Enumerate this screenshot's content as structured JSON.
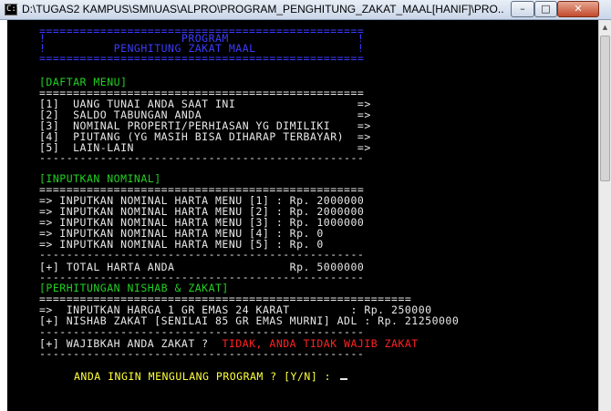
{
  "window": {
    "title": "D:\\TUGAS2 KAMPUS\\SMI\\UAS\\ALPRO\\PROGRAM_PENGHITUNG_ZAKAT_MAAL[HANIF]\\PRO...",
    "icon_label": "C:\\",
    "buttons": {
      "minimize": "–",
      "maximize": "□",
      "close": "✕"
    }
  },
  "console": {
    "header": {
      "border_top": "================================================",
      "line1": "!                    PROGRAM                   !",
      "line2": "!          PENGHITUNG ZAKAT MAAL               !",
      "border_bottom": "================================================"
    },
    "menu": {
      "heading": "[DAFTAR MENU]",
      "rule": "================================================",
      "items": [
        "[1]  UANG TUNAI ANDA SAAT INI                  =>",
        "[2]  SALDO TABUNGAN ANDA                       =>",
        "[3]  NOMINAL PROPERTI/PERHIASAN YG DIMILIKI    =>",
        "[4]  PIUTANG (YG MASIH BISA DIHARAP TERBAYAR)  =>",
        "[5]  LAIN-LAIN                                 =>"
      ],
      "rule_bottom": "------------------------------------------------"
    },
    "input": {
      "heading": "[INPUTKAN NOMINAL]",
      "rule": "================================================",
      "rows": [
        "=> INPUTKAN NOMINAL HARTA MENU [1] : Rp. 2000000",
        "=> INPUTKAN NOMINAL HARTA MENU [2] : Rp. 2000000",
        "=> INPUTKAN NOMINAL HARTA MENU [3] : Rp. 1000000",
        "=> INPUTKAN NOMINAL HARTA MENU [4] : Rp. 0",
        "=> INPUTKAN NOMINAL HARTA MENU [5] : Rp. 0"
      ],
      "rule_mid": "------------------------------------------------",
      "total": "[+] TOTAL HARTA ANDA                 Rp. 5000000",
      "rule_bottom": "------------------------------------------------"
    },
    "calc": {
      "heading": "[PERHITUNGAN NISHAB & ZAKAT]",
      "rule": "=======================================================",
      "row1": "=>  INPUTKAN HARGA 1 GR EMAS 24 KARAT         : Rp. 250000",
      "row2": "[+] NISHAB ZAKAT [SENILAI 85 GR EMAS MURNI] ADL : Rp. 21250000",
      "rule_mid": "------------------------------------------------",
      "question": "[+] WAJIBKAH ANDA ZAKAT ?  ",
      "answer": "TIDAK, ANDA TIDAK WAJIB ZAKAT",
      "rule_bottom": "------------------------------------------------"
    },
    "prompt": "ANDA INGIN MENGULANG PROGRAM ? [Y/N] : "
  },
  "colors": {
    "background": "#000000",
    "header": "#3b3bff",
    "heading": "#22d022",
    "text": "#e8e8e8",
    "prompt": "#ffff3a",
    "answer": "#ff2222"
  }
}
